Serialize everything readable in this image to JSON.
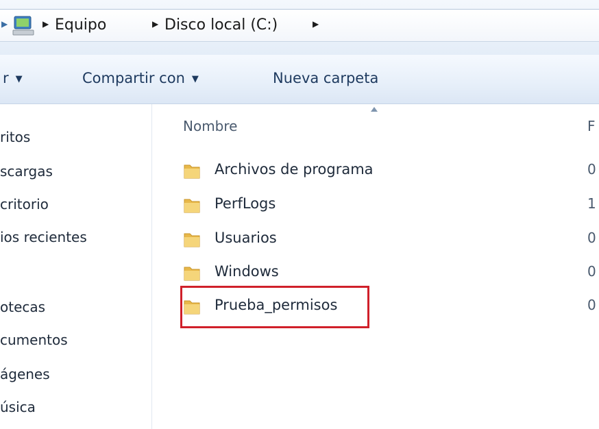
{
  "address_bar": {
    "breadcrumbs": [
      "Equipo",
      "Disco local (C:)"
    ]
  },
  "toolbar": {
    "organize_label": "r",
    "share_label": "Compartir con",
    "new_folder_label": "Nueva carpeta"
  },
  "nav": {
    "items": [
      "ritos",
      "scargas",
      "critorio",
      "ios recientes",
      "otecas",
      "cumentos",
      "ágenes",
      "úsica"
    ]
  },
  "content": {
    "column_name": "Nombre",
    "column_date": "F",
    "rows": [
      {
        "name": "Archivos de programa",
        "date": "0"
      },
      {
        "name": "PerfLogs",
        "date": "1"
      },
      {
        "name": "Usuarios",
        "date": "0"
      },
      {
        "name": "Windows",
        "date": "0"
      },
      {
        "name": "Prueba_permisos",
        "date": "0"
      }
    ]
  },
  "colors": {
    "highlight": "#d0202a",
    "folder": "#e8b84a"
  },
  "icons": [
    "computer-icon",
    "folder-icon",
    "chevron-right-icon",
    "chevron-down-icon"
  ]
}
